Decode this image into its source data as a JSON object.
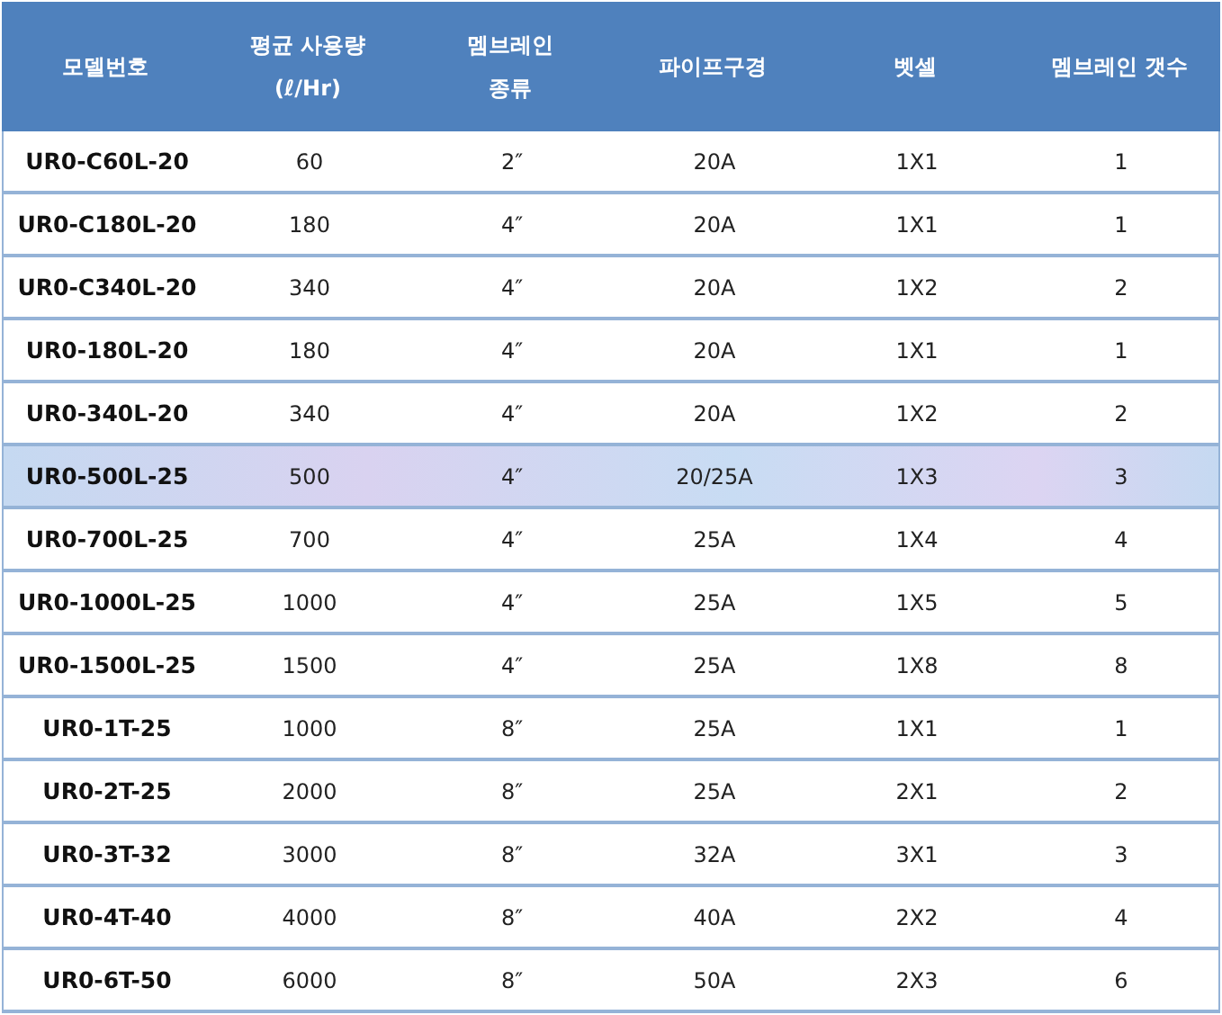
{
  "table": {
    "columns": [
      "모델번호",
      "평균 사용량\n(ℓ/Hr)",
      "멤브레인\n종류",
      "파이프구경",
      "벳셀",
      "멤브레인 갯수"
    ],
    "rows": [
      {
        "selected": false,
        "cells": [
          "UR0-C60L-20",
          "60",
          "2″",
          "20A",
          "1X1",
          "1"
        ]
      },
      {
        "selected": false,
        "cells": [
          "UR0-C180L-20",
          "180",
          "4″",
          "20A",
          "1X1",
          "1"
        ]
      },
      {
        "selected": false,
        "cells": [
          "UR0-C340L-20",
          "340",
          "4″",
          "20A",
          "1X2",
          "2"
        ]
      },
      {
        "selected": false,
        "cells": [
          "UR0-180L-20",
          "180",
          "4″",
          "20A",
          "1X1",
          "1"
        ]
      },
      {
        "selected": false,
        "cells": [
          "UR0-340L-20",
          "340",
          "4″",
          "20A",
          "1X2",
          "2"
        ]
      },
      {
        "selected": true,
        "cells": [
          "UR0-500L-25",
          "500",
          "4″",
          "20/25A",
          "1X3",
          "3"
        ]
      },
      {
        "selected": false,
        "cells": [
          "UR0-700L-25",
          "700",
          "4″",
          "25A",
          "1X4",
          "4"
        ]
      },
      {
        "selected": false,
        "cells": [
          "UR0-1000L-25",
          "1000",
          "4″",
          "25A",
          "1X5",
          "5"
        ]
      },
      {
        "selected": false,
        "cells": [
          "UR0-1500L-25",
          "1500",
          "4″",
          "25A",
          "1X8",
          "8"
        ]
      },
      {
        "selected": false,
        "cells": [
          "UR0-1T-25",
          "1000",
          "8″",
          "25A",
          "1X1",
          "1"
        ]
      },
      {
        "selected": false,
        "cells": [
          "UR0-2T-25",
          "2000",
          "8″",
          "25A",
          "2X1",
          "2"
        ]
      },
      {
        "selected": false,
        "cells": [
          "UR0-3T-32",
          "3000",
          "8″",
          "32A",
          "3X1",
          "3"
        ]
      },
      {
        "selected": false,
        "cells": [
          "UR0-4T-40",
          "4000",
          "8″",
          "40A",
          "2X2",
          "4"
        ]
      },
      {
        "selected": false,
        "cells": [
          "UR0-6T-50",
          "6000",
          "8″",
          "50A",
          "2X3",
          "6"
        ]
      }
    ]
  }
}
